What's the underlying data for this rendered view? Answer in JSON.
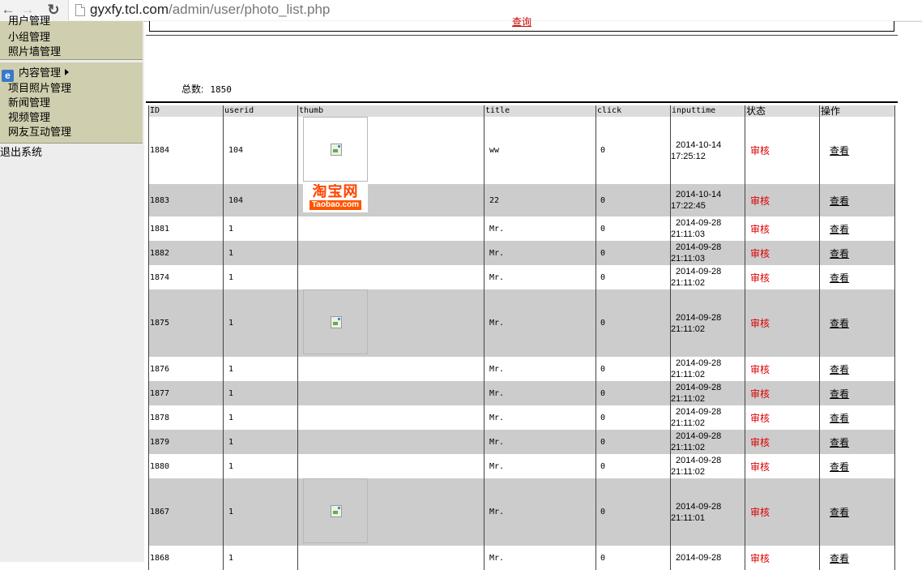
{
  "browser": {
    "back": "←",
    "forward": "→",
    "reload": "↻",
    "url_host": "gyxfy.tcl.com",
    "url_path": "/admin/user/photo_list.php"
  },
  "sidebar": {
    "group1": [
      {
        "label": "用户管理"
      },
      {
        "label": "小组管理"
      },
      {
        "label": "照片墙管理"
      }
    ],
    "group2_head": "内容管理",
    "group2": [
      {
        "label": "项目照片管理"
      },
      {
        "label": "新闻管理"
      },
      {
        "label": "视频管理"
      },
      {
        "label": "网友互动管理"
      }
    ],
    "logout": "退出系统"
  },
  "main": {
    "top_link": "查询",
    "total_label": "总数:",
    "total_value": "1850"
  },
  "table": {
    "headers": [
      "ID",
      "userid",
      "thumb",
      "title",
      "click",
      "inputtime",
      "状态",
      "操作"
    ],
    "rows": [
      {
        "id": "1884",
        "userid": "104",
        "thumb": "image",
        "title": "ww",
        "click": "0",
        "date": "2014-10-14",
        "time": "17:25:12",
        "status": "审核",
        "op": "查看"
      },
      {
        "id": "1883",
        "userid": "104",
        "thumb": "taobao",
        "title": "22",
        "click": "0",
        "date": "2014-10-14",
        "time": "17:22:45",
        "status": "审核",
        "op": "查看"
      },
      {
        "id": "1881",
        "userid": "1",
        "thumb": "",
        "title": "Mr.",
        "click": "0",
        "date": "2014-09-28",
        "time": "21:11:03",
        "status": "审核",
        "op": "查看"
      },
      {
        "id": "1882",
        "userid": "1",
        "thumb": "",
        "title": "Mr.",
        "click": "0",
        "date": "2014-09-28",
        "time": "21:11:03",
        "status": "审核",
        "op": "查看"
      },
      {
        "id": "1874",
        "userid": "1",
        "thumb": "",
        "title": "Mr.",
        "click": "0",
        "date": "2014-09-28",
        "time": "21:11:02",
        "status": "审核",
        "op": "查看"
      },
      {
        "id": "1875",
        "userid": "1",
        "thumb": "image",
        "title": "Mr.",
        "click": "0",
        "date": "2014-09-28",
        "time": "21:11:02",
        "status": "审核",
        "op": "查看"
      },
      {
        "id": "1876",
        "userid": "1",
        "thumb": "",
        "title": "Mr.",
        "click": "0",
        "date": "2014-09-28",
        "time": "21:11:02",
        "status": "审核",
        "op": "查看"
      },
      {
        "id": "1877",
        "userid": "1",
        "thumb": "",
        "title": "Mr.",
        "click": "0",
        "date": "2014-09-28",
        "time": "21:11:02",
        "status": "审核",
        "op": "查看"
      },
      {
        "id": "1878",
        "userid": "1",
        "thumb": "",
        "title": "Mr.",
        "click": "0",
        "date": "2014-09-28",
        "time": "21:11:02",
        "status": "审核",
        "op": "查看"
      },
      {
        "id": "1879",
        "userid": "1",
        "thumb": "",
        "title": "Mr.",
        "click": "0",
        "date": "2014-09-28",
        "time": "21:11:02",
        "status": "审核",
        "op": "查看"
      },
      {
        "id": "1880",
        "userid": "1",
        "thumb": "",
        "title": "Mr.",
        "click": "0",
        "date": "2014-09-28",
        "time": "21:11:02",
        "status": "审核",
        "op": "查看"
      },
      {
        "id": "1867",
        "userid": "1",
        "thumb": "image",
        "title": "Mr.",
        "click": "0",
        "date": "2014-09-28",
        "time": "21:11:01",
        "status": "审核",
        "op": "查看"
      },
      {
        "id": "1868",
        "userid": "1",
        "thumb": "",
        "title": "Mr.",
        "click": "0",
        "date": "2014-09-28",
        "time": "",
        "status": "审核",
        "op": "查看"
      }
    ]
  },
  "taobao": {
    "cn": "淘宝网",
    "en": "Taobao.com"
  },
  "colors": {
    "sidebar_group": "#cfcfaf",
    "row_alt": "#cccccc",
    "status_red": "#dd0000"
  }
}
